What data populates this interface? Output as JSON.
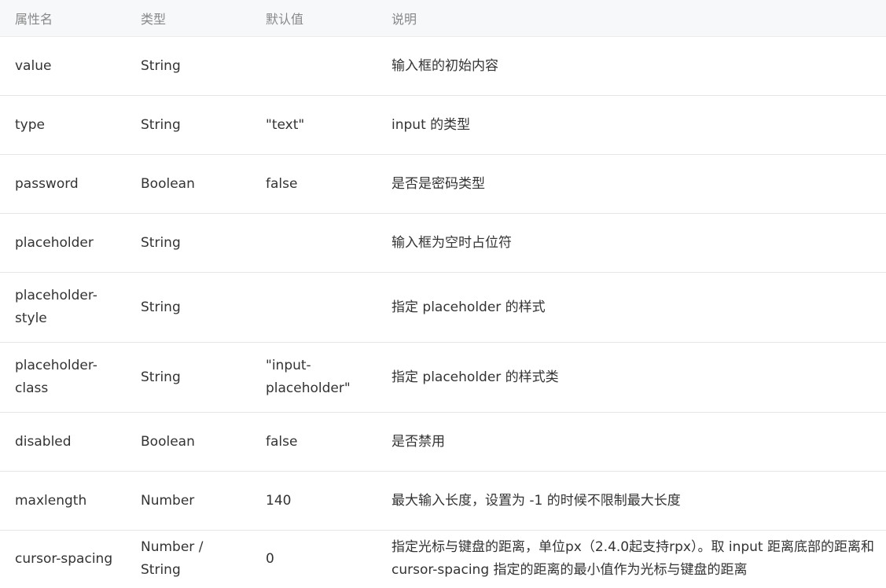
{
  "table": {
    "headers": [
      "属性名",
      "类型",
      "默认值",
      "说明"
    ],
    "rows": [
      {
        "name": "value",
        "type": "String",
        "default": "",
        "desc": "输入框的初始内容"
      },
      {
        "name": "type",
        "type": "String",
        "default": "\"text\"",
        "desc": "input 的类型"
      },
      {
        "name": "password",
        "type": "Boolean",
        "default": "false",
        "desc": "是否是密码类型"
      },
      {
        "name": "placeholder",
        "type": "String",
        "default": "",
        "desc": "输入框为空时占位符"
      },
      {
        "name": "placeholder-style",
        "type": "String",
        "default": "",
        "desc": "指定 placeholder 的样式"
      },
      {
        "name": "placeholder-class",
        "type": "String",
        "default": "\"input-placeholder\"",
        "desc": "指定 placeholder 的样式类"
      },
      {
        "name": "disabled",
        "type": "Boolean",
        "default": "false",
        "desc": "是否禁用"
      },
      {
        "name": "maxlength",
        "type": "Number",
        "default": "140",
        "desc": "最大输入长度，设置为 -1 的时候不限制最大长度"
      },
      {
        "name": "cursor-spacing",
        "type": "Number / String",
        "default": "0",
        "desc": "指定光标与键盘的距离，单位px（2.4.0起支持rpx）。取 input 距离底部的距离和 cursor-spacing 指定的距离的最小值作为光标与键盘的距离"
      }
    ]
  }
}
